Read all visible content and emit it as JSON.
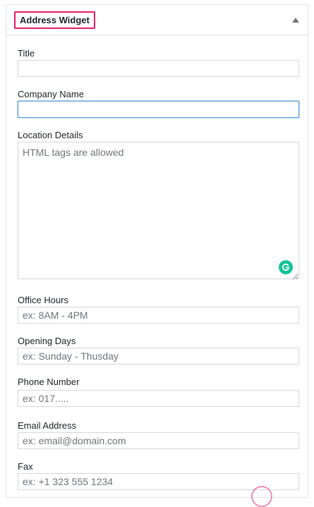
{
  "widget": {
    "title": "Address Widget",
    "toggle_icon": "caret-up-icon",
    "accent_color": "#e5236b"
  },
  "fields": {
    "title": {
      "label": "Title",
      "value": "",
      "placeholder": ""
    },
    "company_name": {
      "label": "Company Name",
      "value": "",
      "placeholder": "",
      "focused": true
    },
    "location_details": {
      "label": "Location Details",
      "value": "",
      "placeholder": "HTML tags are allowed"
    },
    "office_hours": {
      "label": "Office Hours",
      "value": "",
      "placeholder": "ex: 8AM - 4PM"
    },
    "opening_days": {
      "label": "Opening Days",
      "value": "",
      "placeholder": "ex: Sunday - Thusday"
    },
    "phone_number": {
      "label": "Phone Number",
      "value": "",
      "placeholder": "ex: 017....."
    },
    "email_address": {
      "label": "Email Address",
      "value": "",
      "placeholder": "ex: email@domain.com"
    },
    "fax": {
      "label": "Fax",
      "value": "",
      "placeholder": "ex: +1 323 555 1234"
    }
  },
  "grammarly": {
    "icon": "grammarly-icon",
    "color": "#15c39a"
  }
}
